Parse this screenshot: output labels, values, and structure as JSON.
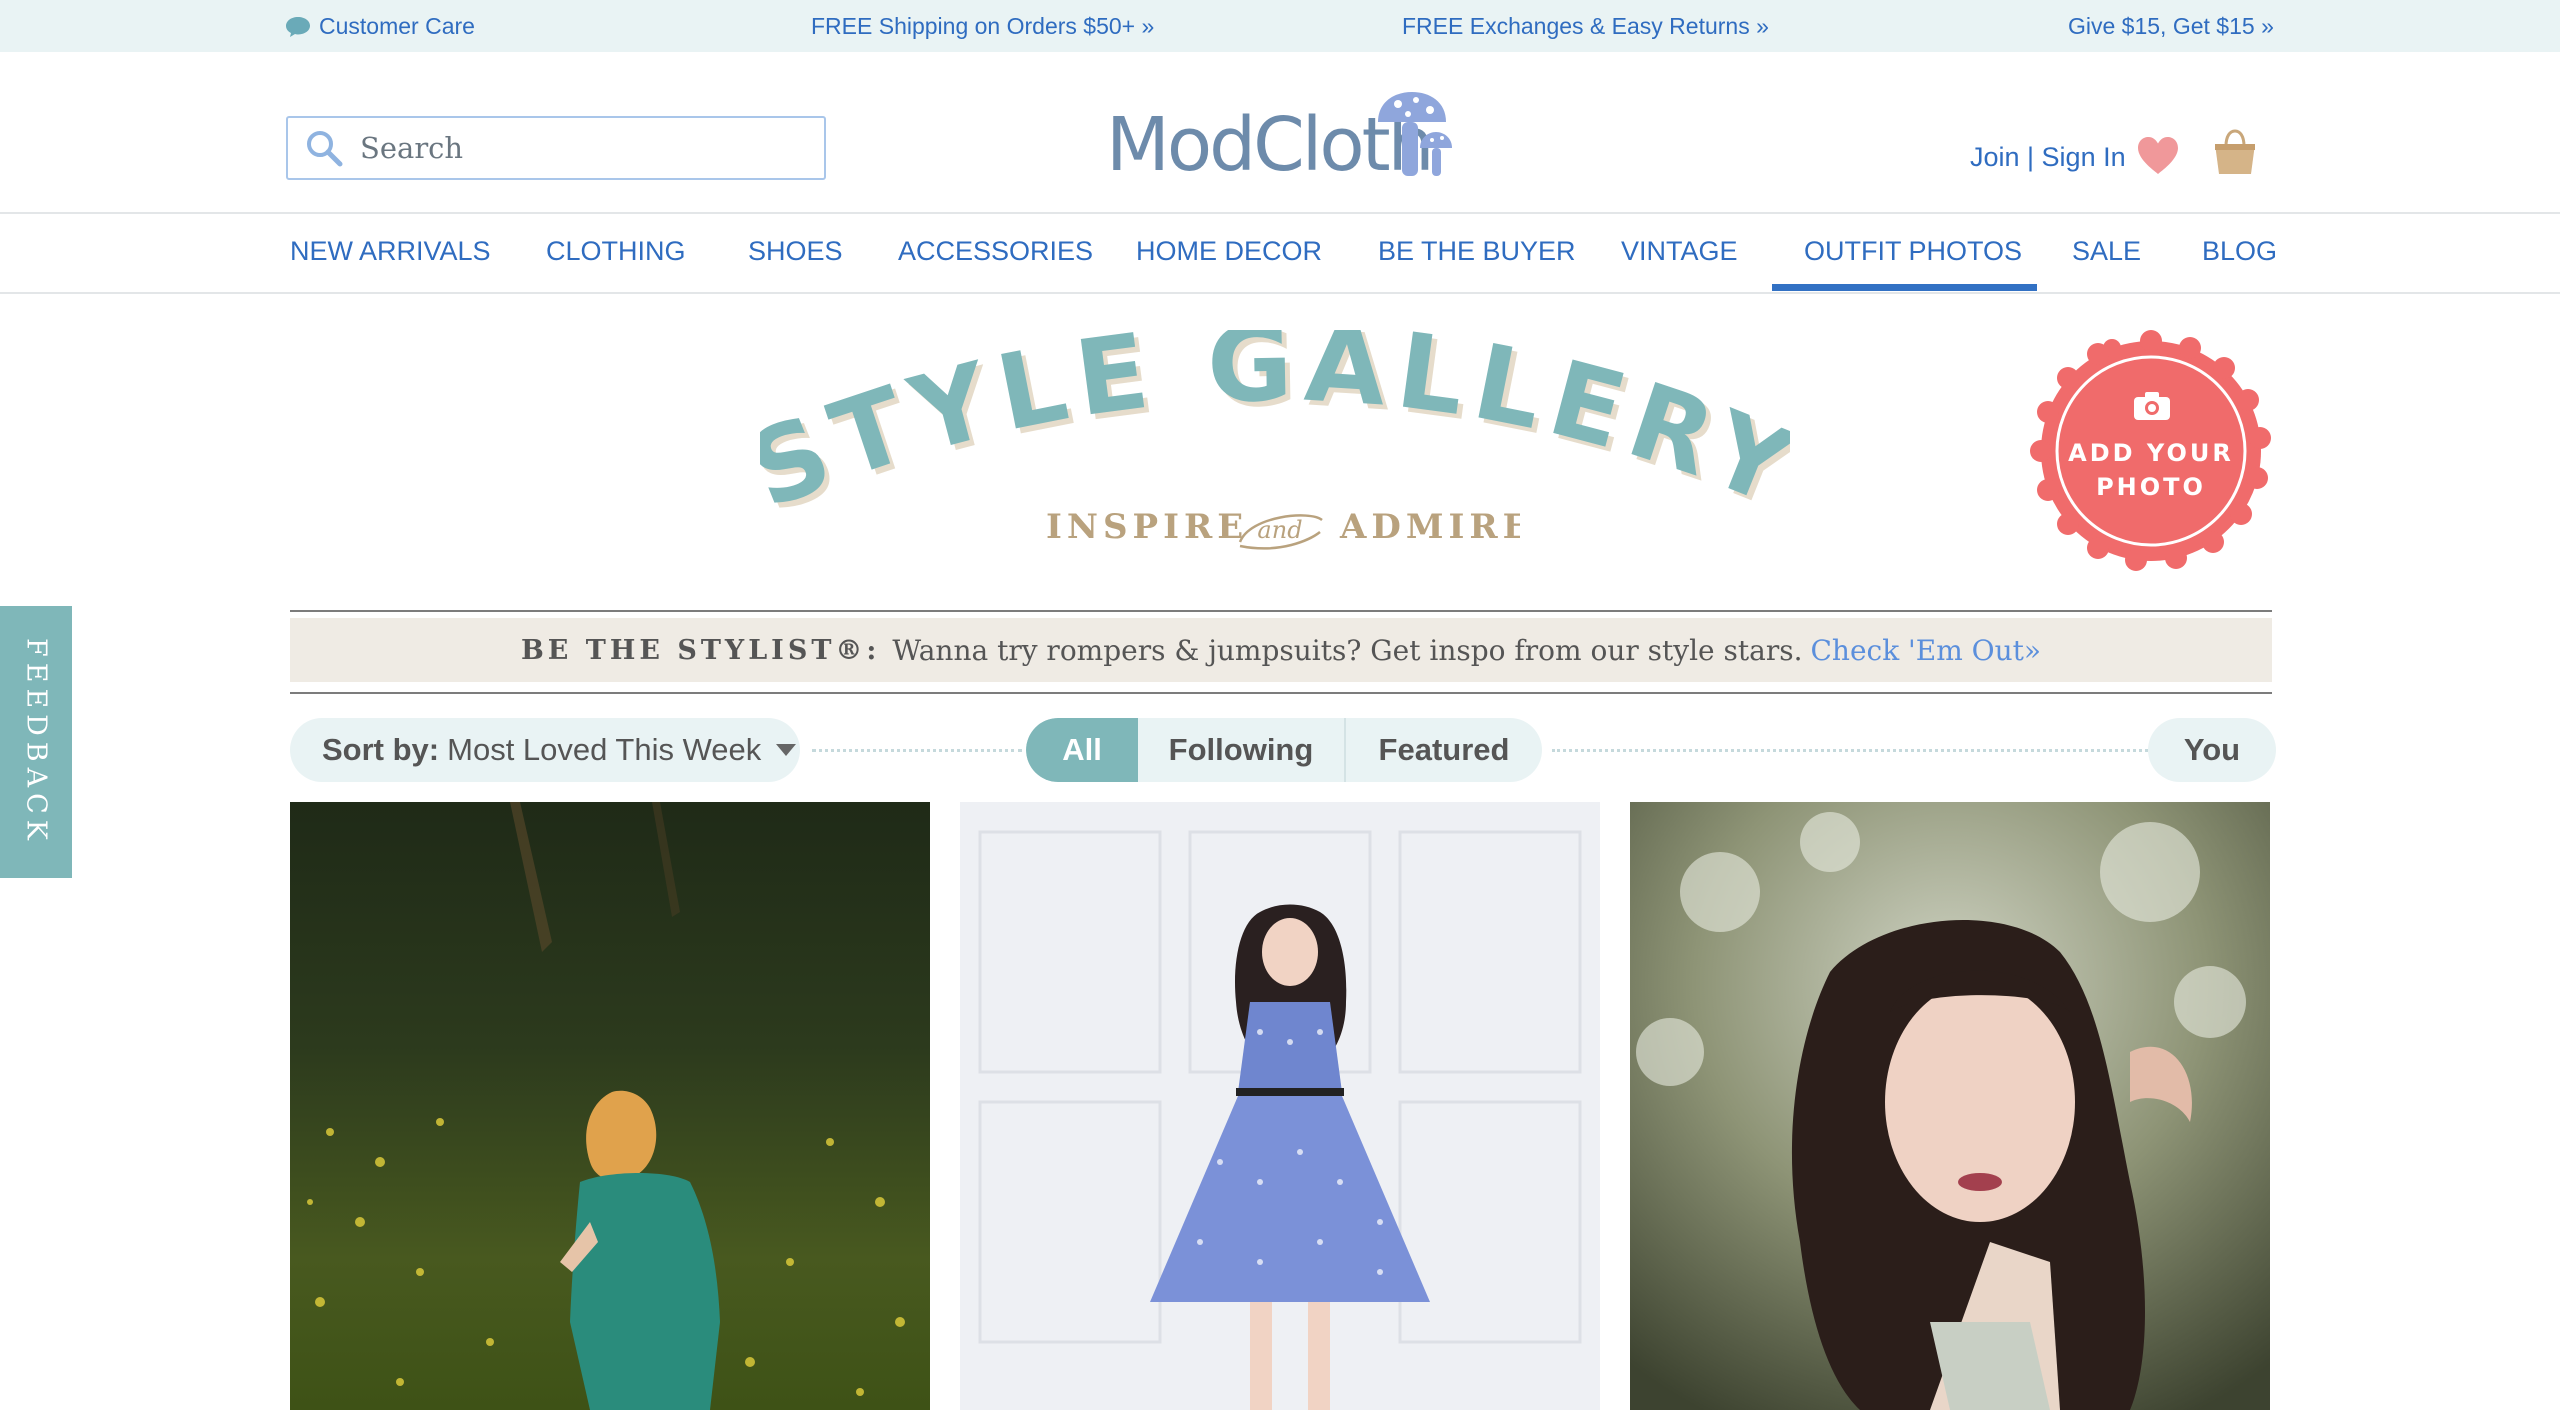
{
  "promo_bar": {
    "customer_care": "Customer Care",
    "shipping": "FREE Shipping on Orders $50+ »",
    "exchanges": "FREE Exchanges & Easy Returns »",
    "give": "Give $15, Get $15 »"
  },
  "header": {
    "search_placeholder": "Search",
    "logo": "ModCloth",
    "account": "Join | Sign In"
  },
  "nav": {
    "items": [
      "NEW ARRIVALS",
      "CLOTHING",
      "SHOES",
      "ACCESSORIES",
      "HOME DECOR",
      "BE THE BUYER",
      "VINTAGE",
      "OUTFIT PHOTOS",
      "SALE",
      "BLOG"
    ],
    "active": "OUTFIT PHOTOS"
  },
  "gallery": {
    "title": "STYLE GALLERY",
    "tagline_left": "INSPIRE",
    "tagline_mid": "and",
    "tagline_right": "ADMIRE",
    "add_photo_line1": "ADD YOUR",
    "add_photo_line2": "PHOTO"
  },
  "stylist_bar": {
    "label": "BE THE STYLIST®:",
    "text": "Wanna try rompers & jumpsuits? Get inspo from our style stars.",
    "link": "Check 'Em Out»"
  },
  "filters": {
    "sort_label": "Sort by:",
    "sort_value": "Most Loved This Week",
    "tabs": [
      "All",
      "Following",
      "Featured"
    ],
    "active_tab": "All",
    "you": "You"
  },
  "feedback": "FEEDBACK",
  "colors": {
    "link_blue": "#2f6cc0",
    "teal": "#7fb7b9",
    "coral": "#f06b6b",
    "tan": "#b9a27e",
    "promo_bg": "#e9f3f4"
  },
  "icons": [
    "chat-icon",
    "search-icon",
    "mushroom-icon",
    "heart-icon",
    "shopping-bag-icon",
    "camera-icon",
    "caret-down-icon"
  ]
}
